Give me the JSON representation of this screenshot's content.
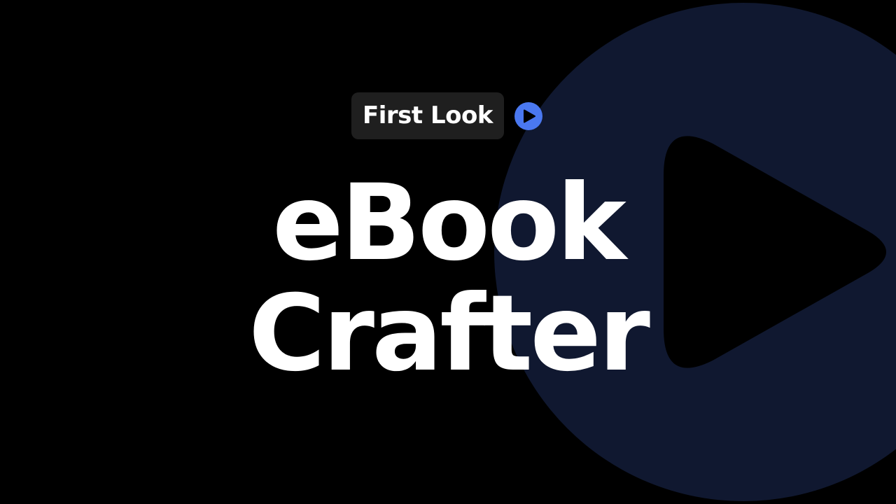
{
  "badge": {
    "label": "First Look",
    "icon": "play-icon"
  },
  "title": {
    "line1": "eBook",
    "line2": "Crafter"
  },
  "background": {
    "icon": "large-play-icon"
  },
  "colors": {
    "background": "#000000",
    "circle": "#101830",
    "badge_bg": "#1f1f1f",
    "accent": "#4a78f0",
    "text": "#ffffff"
  }
}
